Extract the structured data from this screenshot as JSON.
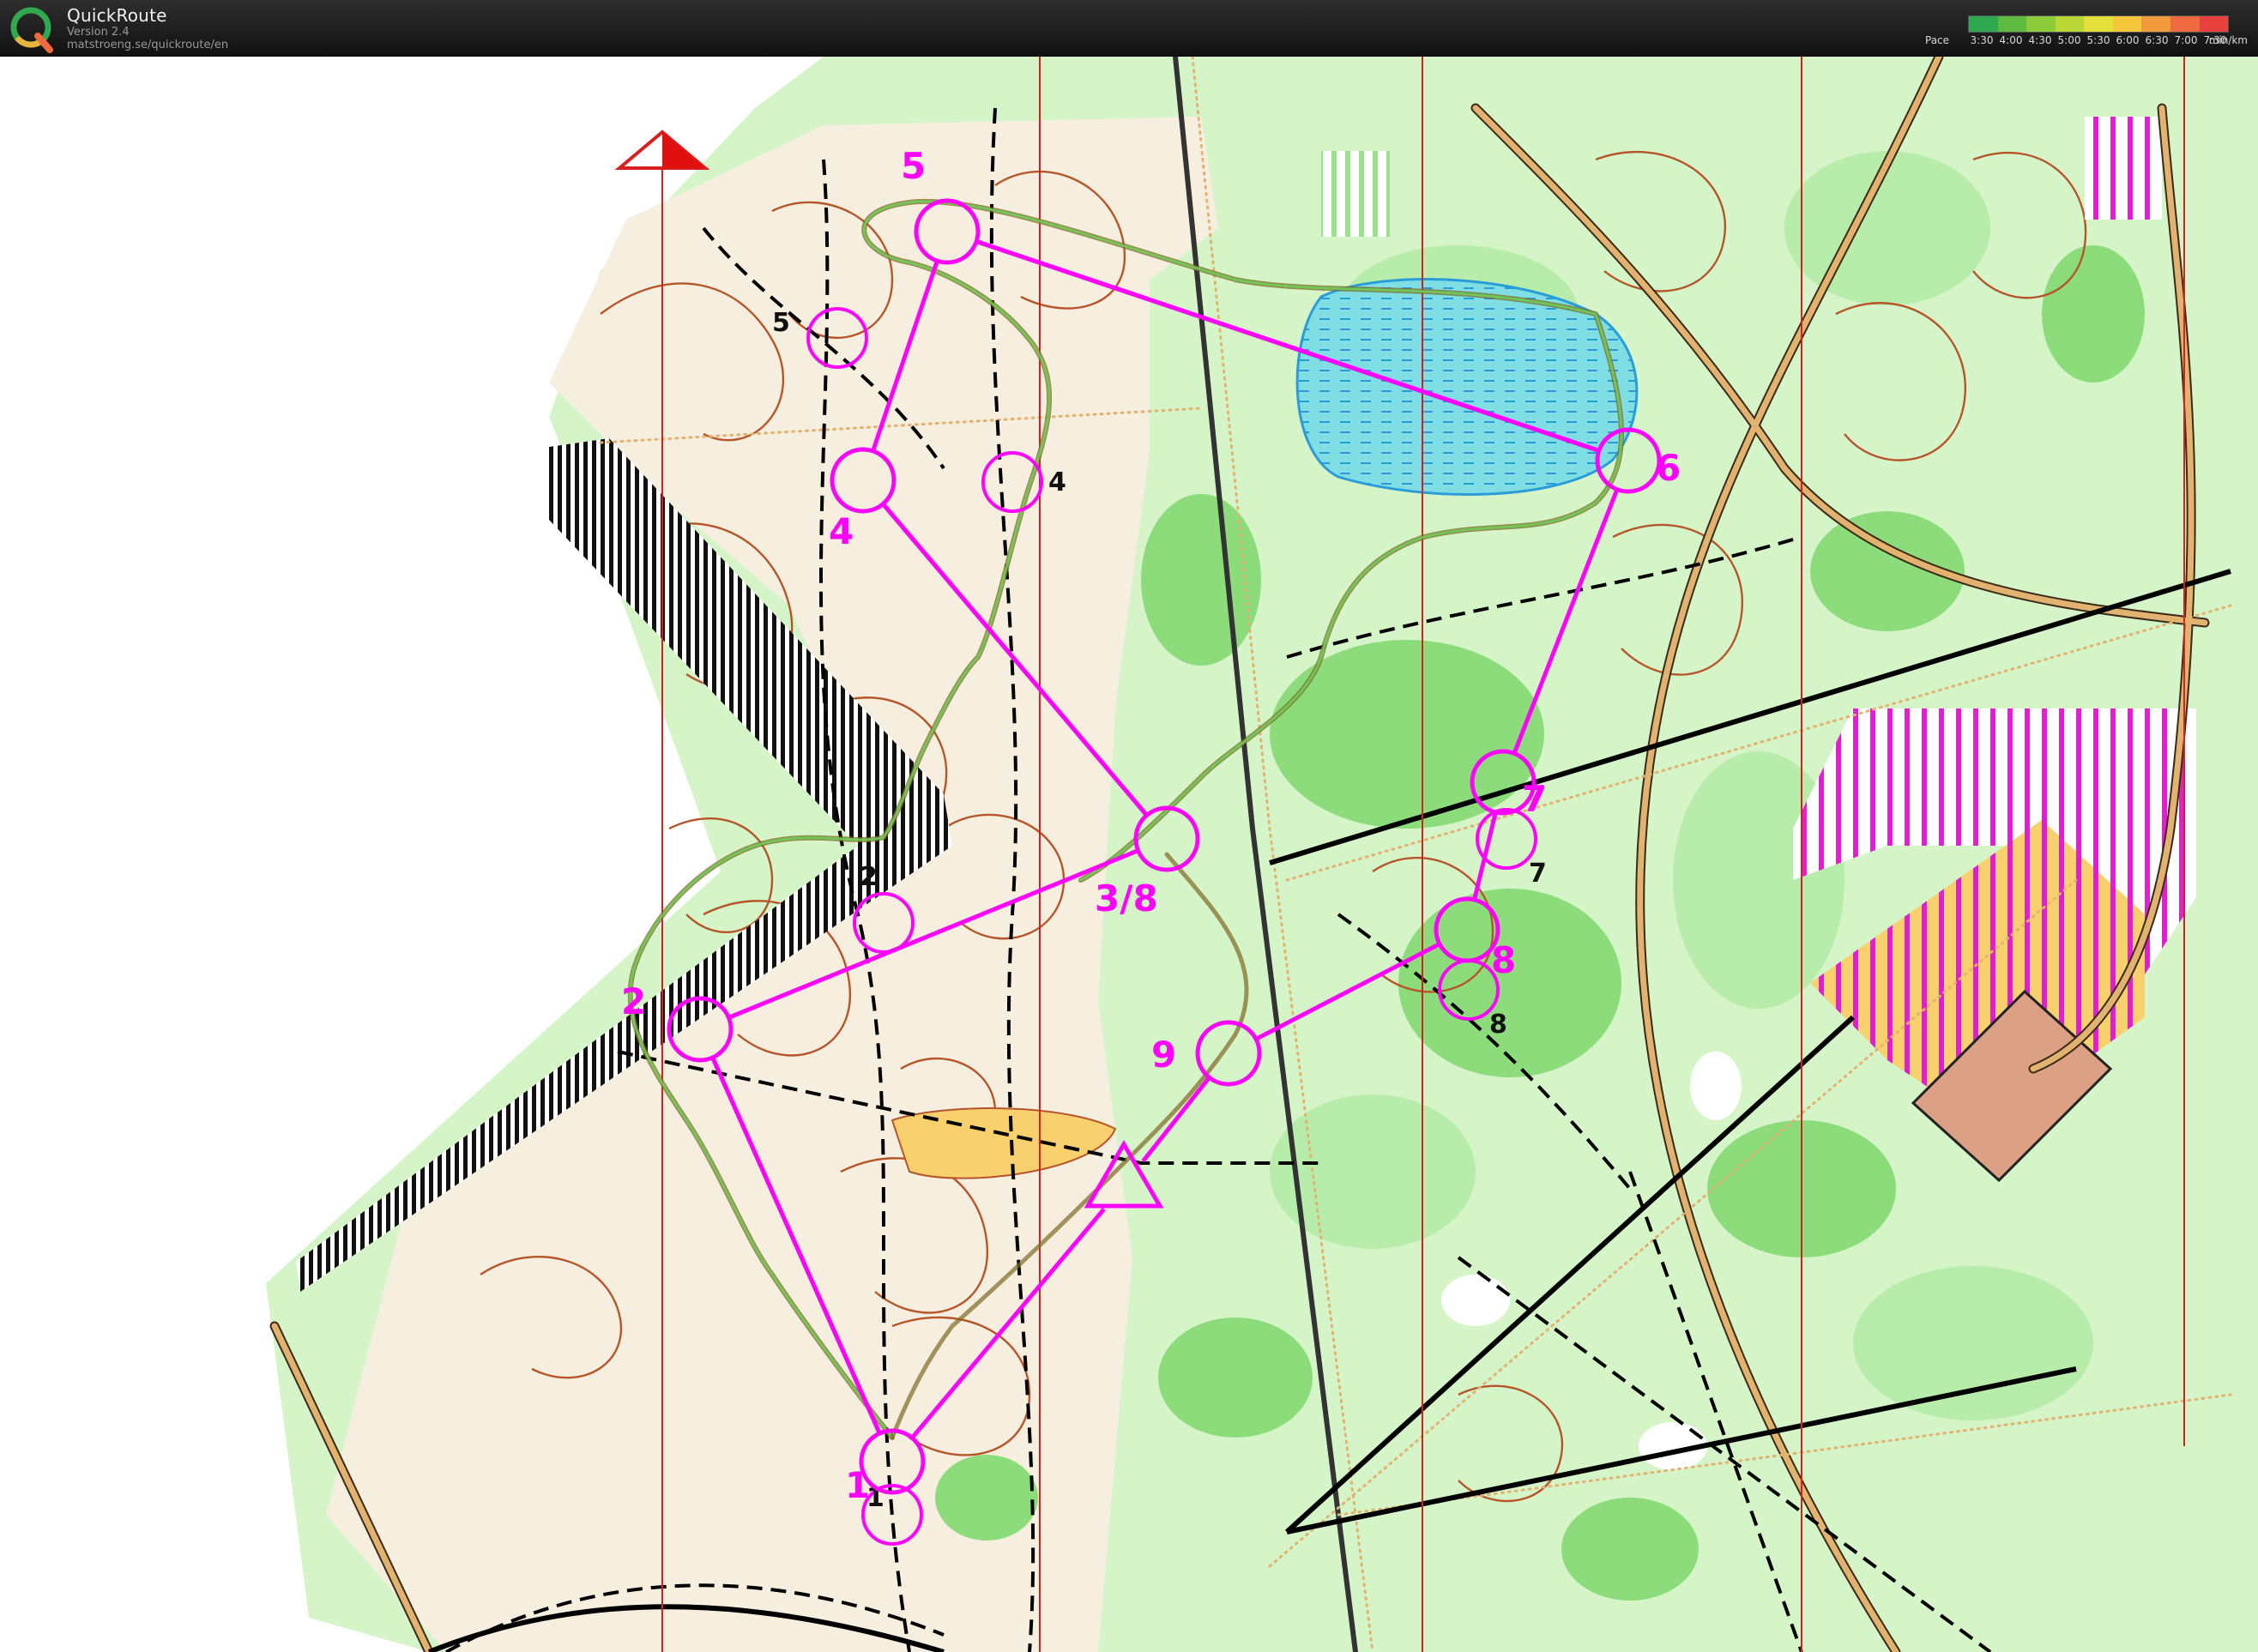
{
  "app": {
    "name": "QuickRoute",
    "version": "Version 2.4",
    "url": "matstroeng.se/quickroute/en",
    "logo_icon": "quickroute-q-logo-icon"
  },
  "pace_legend": {
    "label": "Pace",
    "ticks": [
      "3:30",
      "4:00",
      "4:30",
      "5:00",
      "5:30",
      "6:00",
      "6:30",
      "7:00",
      "7:30"
    ],
    "unit": "min/km",
    "colors": [
      "#2fa84f",
      "#5dbb3f",
      "#8dcb3b",
      "#b9d838",
      "#e3e03a",
      "#f3c63c",
      "#f39a3e",
      "#ef6b3f",
      "#e8403f"
    ]
  },
  "course": {
    "color": "#ff00ff",
    "controls": [
      {
        "label": "1"
      },
      {
        "label": "2"
      },
      {
        "label": "3/8"
      },
      {
        "label": "4"
      },
      {
        "label": "5"
      },
      {
        "label": "6"
      },
      {
        "label": "7"
      },
      {
        "label": "8"
      },
      {
        "label": "9"
      }
    ]
  },
  "second_course": {
    "controls": [
      {
        "label": "1"
      },
      {
        "label": "2"
      },
      {
        "label": "4"
      },
      {
        "label": "5"
      },
      {
        "label": "7"
      },
      {
        "label": "8"
      }
    ]
  },
  "map_colors": {
    "open": "#ffffff",
    "forest_light": "#c6f0b6",
    "forest_dark": "#7ad66a",
    "contour": "#b5562a",
    "path": "#000000",
    "road": "#d69a4e",
    "water": "#66d6e0",
    "field": "#f8d16e",
    "building": "#dca084",
    "north_line": "#d62020"
  }
}
